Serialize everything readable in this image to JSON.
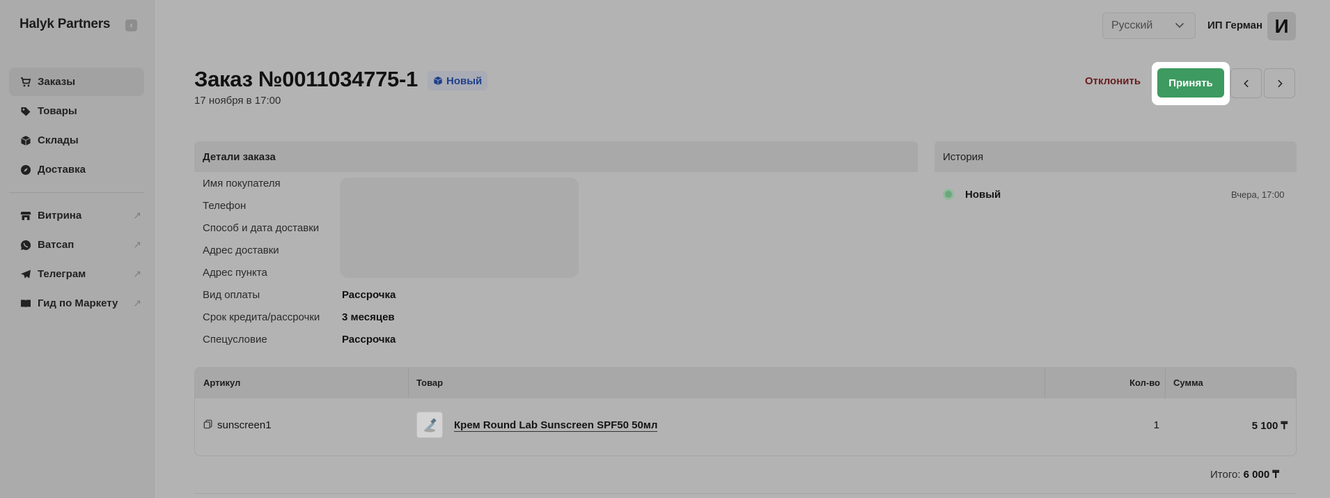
{
  "sidebar": {
    "brand": "Halyk Partners",
    "collapse_icon": "chevron-left-icon",
    "items": [
      {
        "label": "Заказы",
        "icon": "cart-icon",
        "active": true,
        "external": false
      },
      {
        "label": "Товары",
        "icon": "tag-icon",
        "active": false,
        "external": false
      },
      {
        "label": "Склады",
        "icon": "box-icon",
        "active": false,
        "external": false
      },
      {
        "label": "Доставка",
        "icon": "compass-icon",
        "active": false,
        "external": false
      }
    ],
    "external_items": [
      {
        "label": "Витрина",
        "icon": "store-icon",
        "external": true
      },
      {
        "label": "Ватсап",
        "icon": "whatsapp-icon",
        "external": true
      },
      {
        "label": "Телеграм",
        "icon": "telegram-icon",
        "external": true
      },
      {
        "label": "Гид по Маркету",
        "icon": "book-icon",
        "external": true
      }
    ]
  },
  "topbar": {
    "language": "Русский",
    "user_name": "ИП Герман",
    "avatar_letter": "И"
  },
  "order": {
    "title": "Заказ №0011034775-1",
    "status": "Новый",
    "date": "17 ноября в 17:00",
    "reject_label": "Отклонить",
    "accept_label": "Принять"
  },
  "details": {
    "heading": "Детали заказа",
    "rows": [
      {
        "label": "Имя покупателя",
        "value": ""
      },
      {
        "label": "Телефон",
        "value": ""
      },
      {
        "label": "Способ и дата доставки",
        "value": ""
      },
      {
        "label": "Адрес доставки",
        "value": ""
      },
      {
        "label": "Адрес пункта",
        "value": ""
      },
      {
        "label": "Вид оплаты",
        "value": "Рассрочка"
      },
      {
        "label": "Срок кредита/рассрочки",
        "value": "3 месяцев"
      },
      {
        "label": "Спецусловие",
        "value": "Рассрочка"
      }
    ]
  },
  "history": {
    "heading": "История",
    "entries": [
      {
        "status": "Новый",
        "time": "Вчера, 17:00"
      }
    ]
  },
  "table": {
    "headers": {
      "sku": "Артикул",
      "product": "Товар",
      "qty": "Кол-во",
      "sum": "Сумма"
    },
    "rows": [
      {
        "sku": "sunscreen1",
        "product": "Крем Round Lab Sunscreen SPF50 50мл",
        "qty": "1",
        "sum": "5 100 ₸"
      }
    ],
    "total_label": "Итого:",
    "total_value": "6 000 ₸"
  },
  "colors": {
    "accent_green": "#3d9a60",
    "reject_red": "#6b1d1d",
    "badge_blue": "#1e3f8a"
  }
}
